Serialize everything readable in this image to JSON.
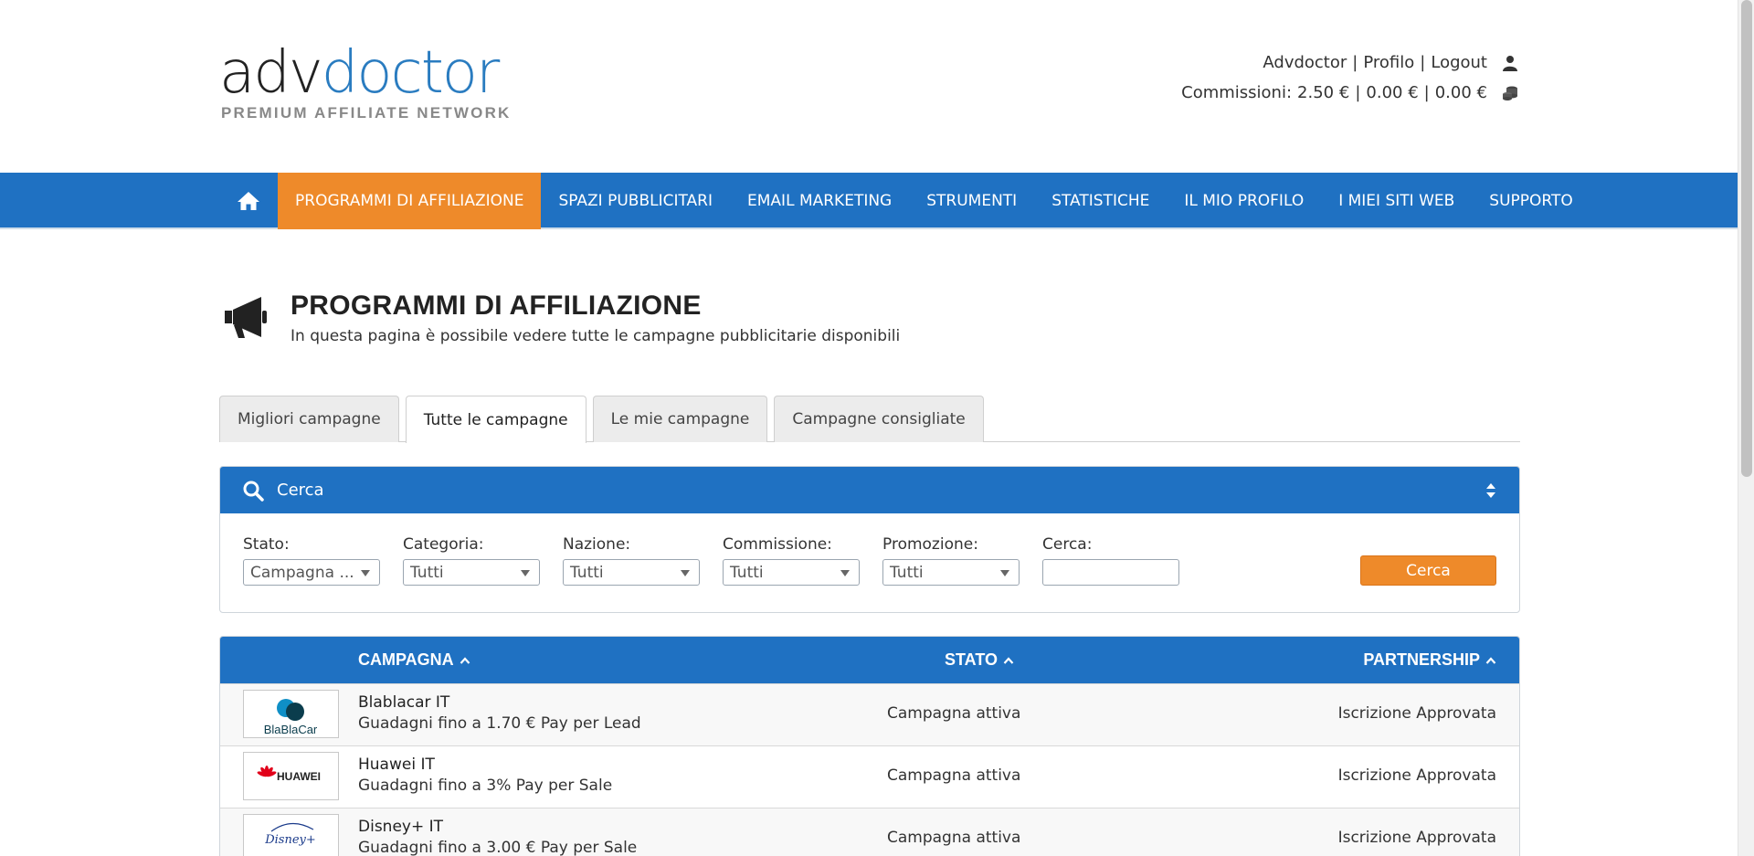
{
  "logo": {
    "part1": "adv",
    "part2": "doctor",
    "tagline": "PREMIUM AFFILIATE NETWORK"
  },
  "user": {
    "name": "Advdoctor",
    "profile": "Profilo",
    "logout": "Logout",
    "commissions_label": "Commissioni:",
    "commissions": [
      "2.50 €",
      "0.00 €",
      "0.00 €"
    ]
  },
  "nav": {
    "items": [
      "PROGRAMMI DI AFFILIAZIONE",
      "SPAZI PUBBLICITARI",
      "EMAIL MARKETING",
      "STRUMENTI",
      "STATISTICHE",
      "IL MIO PROFILO",
      "I MIEI SITI WEB",
      "SUPPORTO"
    ],
    "active_index": 0
  },
  "page": {
    "title": "PROGRAMMI DI AFFILIAZIONE",
    "subtitle": "In questa pagina è possibile vedere tutte le campagne pubblicitarie disponibili"
  },
  "tabs": [
    "Migliori campagne",
    "Tutte le campagne",
    "Le mie campagne",
    "Campagne consigliate"
  ],
  "search": {
    "title": "Cerca",
    "filters": [
      {
        "label": "Stato:",
        "value": "Campagna ..."
      },
      {
        "label": "Categoria:",
        "value": "Tutti"
      },
      {
        "label": "Nazione:",
        "value": "Tutti"
      },
      {
        "label": "Commissione:",
        "value": "Tutti"
      },
      {
        "label": "Promozione:",
        "value": "Tutti"
      }
    ],
    "text_label": "Cerca:",
    "text_value": "",
    "button": "Cerca"
  },
  "table": {
    "headers": {
      "campaign": "CAMPAGNA",
      "status": "STATO",
      "partnership": "PARTNERSHIP"
    },
    "rows": [
      {
        "logo_text": "BlaBlaCar",
        "name": "Blablacar IT",
        "desc": "Guadagni fino a 1.70 € Pay per Lead",
        "status": "Campagna attiva",
        "partnership": "Iscrizione Approvata"
      },
      {
        "logo_text": "HUAWEI",
        "name": "Huawei IT",
        "desc": "Guadagni fino a 3% Pay per Sale",
        "status": "Campagna attiva",
        "partnership": "Iscrizione Approvata"
      },
      {
        "logo_text": "Disney+",
        "name": "Disney+ IT",
        "desc": "Guadagni fino a 3.00 € Pay per Sale",
        "status": "Campagna attiva",
        "partnership": "Iscrizione Approvata"
      }
    ]
  },
  "colors": {
    "brand_blue": "#1f71c2",
    "accent_orange": "#ee8a2a"
  }
}
